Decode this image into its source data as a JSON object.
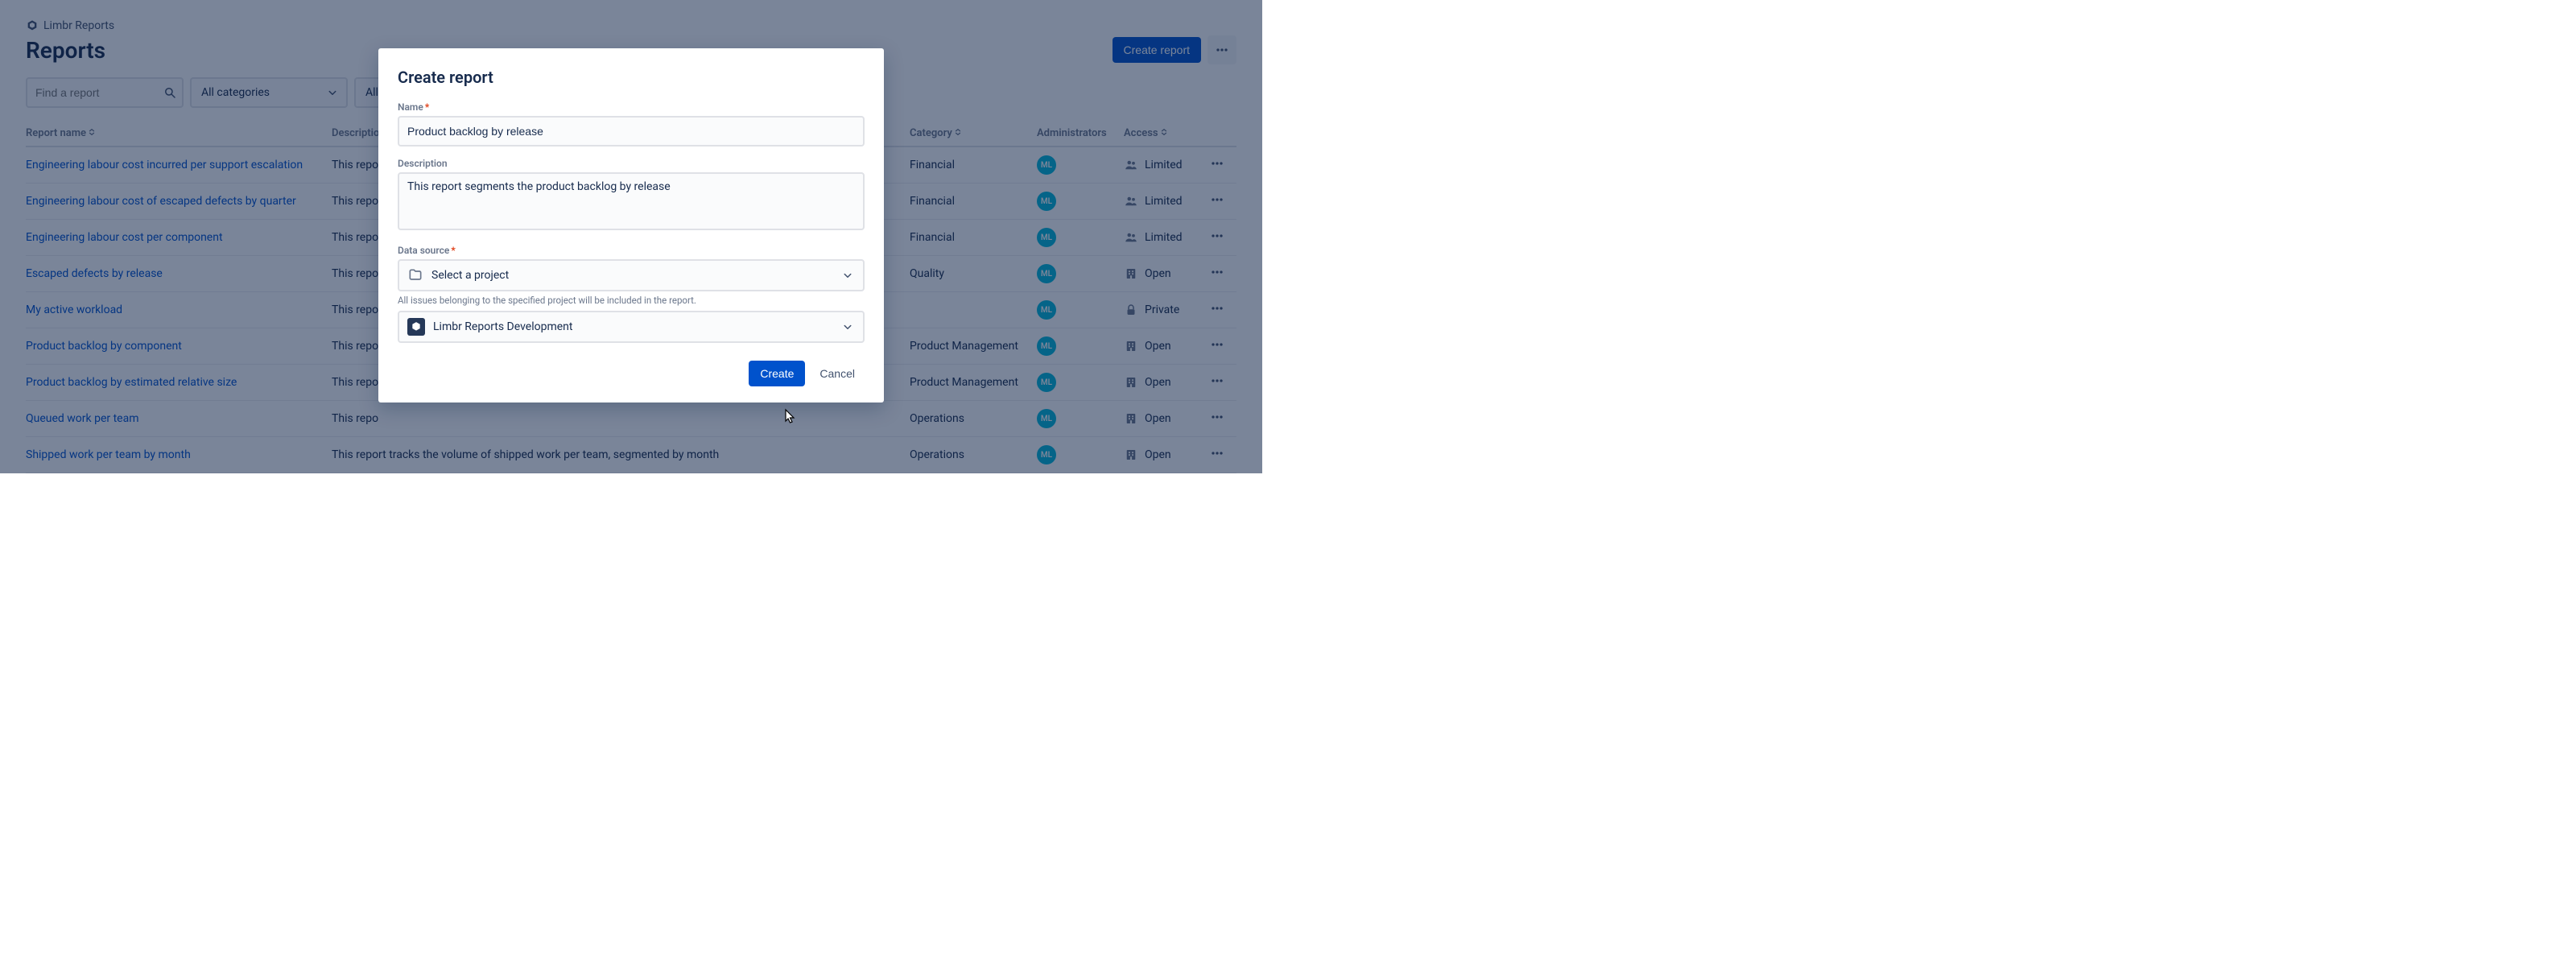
{
  "breadcrumb": {
    "app": "Limbr Reports"
  },
  "header": {
    "title": "Reports",
    "create_label": "Create report"
  },
  "filters": {
    "search_placeholder": "Find a report",
    "category_label": "All categories",
    "access_label": "All a"
  },
  "table": {
    "columns": {
      "name": "Report name",
      "description": "Description",
      "category": "Category",
      "administrators": "Administrators",
      "access": "Access"
    },
    "rows": [
      {
        "name": "Engineering labour cost incurred per support escalation",
        "description": "This repo",
        "category": "Financial",
        "admin": "ML",
        "access": "Limited",
        "access_icon": "group"
      },
      {
        "name": "Engineering labour cost of escaped defects by quarter",
        "description": "This repo",
        "category": "Financial",
        "admin": "ML",
        "access": "Limited",
        "access_icon": "group"
      },
      {
        "name": "Engineering labour cost per component",
        "description": "This repo",
        "category": "Financial",
        "admin": "ML",
        "access": "Limited",
        "access_icon": "group"
      },
      {
        "name": "Escaped defects by release",
        "description": "This repo",
        "category": "Quality",
        "admin": "ML",
        "access": "Open",
        "access_icon": "building"
      },
      {
        "name": "My active workload",
        "description": "This repo",
        "category": "",
        "admin": "ML",
        "access": "Private",
        "access_icon": "lock"
      },
      {
        "name": "Product backlog by component",
        "description": "This repo",
        "category": "Product Management",
        "admin": "ML",
        "access": "Open",
        "access_icon": "building"
      },
      {
        "name": "Product backlog by estimated relative size",
        "description": "This repo",
        "category": "Product Management",
        "admin": "ML",
        "access": "Open",
        "access_icon": "building"
      },
      {
        "name": "Queued work per team",
        "description": "This repo",
        "category": "Operations",
        "admin": "ML",
        "access": "Open",
        "access_icon": "building"
      },
      {
        "name": "Shipped work per team by month",
        "description": "This report tracks the volume of shipped work per team, segmented by month",
        "category": "Operations",
        "admin": "ML",
        "access": "Open",
        "access_icon": "building"
      }
    ]
  },
  "modal": {
    "title": "Create report",
    "name_label": "Name",
    "name_value": "Product backlog by release",
    "description_label": "Description",
    "description_value": "This report segments the product backlog by release",
    "data_source_label": "Data source",
    "data_source_placeholder": "Select a project",
    "data_source_helper": "All issues belonging to the specified project will be included in the report.",
    "project_value": "Limbr Reports Development",
    "create_label": "Create",
    "cancel_label": "Cancel"
  }
}
